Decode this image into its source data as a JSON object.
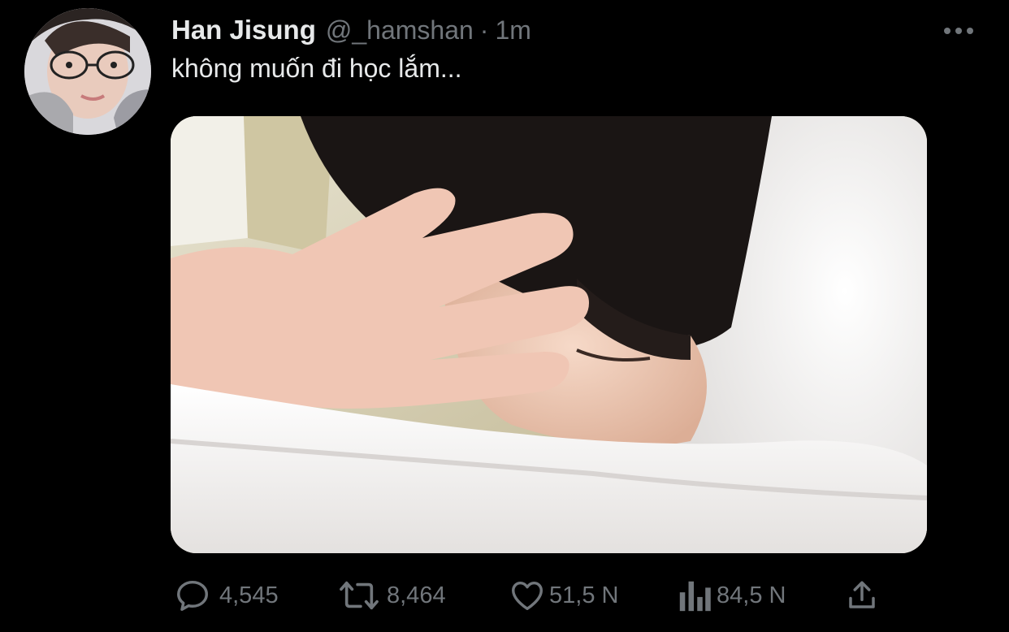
{
  "tweet": {
    "display_name": "Han Jisung",
    "handle": "@_hamshan",
    "separator": "·",
    "time": "1m",
    "text": "không muốn đi học lắm..."
  },
  "icons": {
    "more": "more-horizontal-icon",
    "reply": "reply-icon",
    "retweet": "retweet-icon",
    "like": "heart-icon",
    "views": "views-icon",
    "share": "share-icon"
  },
  "actions": {
    "reply_count": "4,545",
    "retweet_count": "8,464",
    "like_count": "51,5 N",
    "views_count": "84,5 N"
  },
  "colors": {
    "background": "#000000",
    "primary_text": "#e7e9ea",
    "secondary_text": "#71767b"
  }
}
